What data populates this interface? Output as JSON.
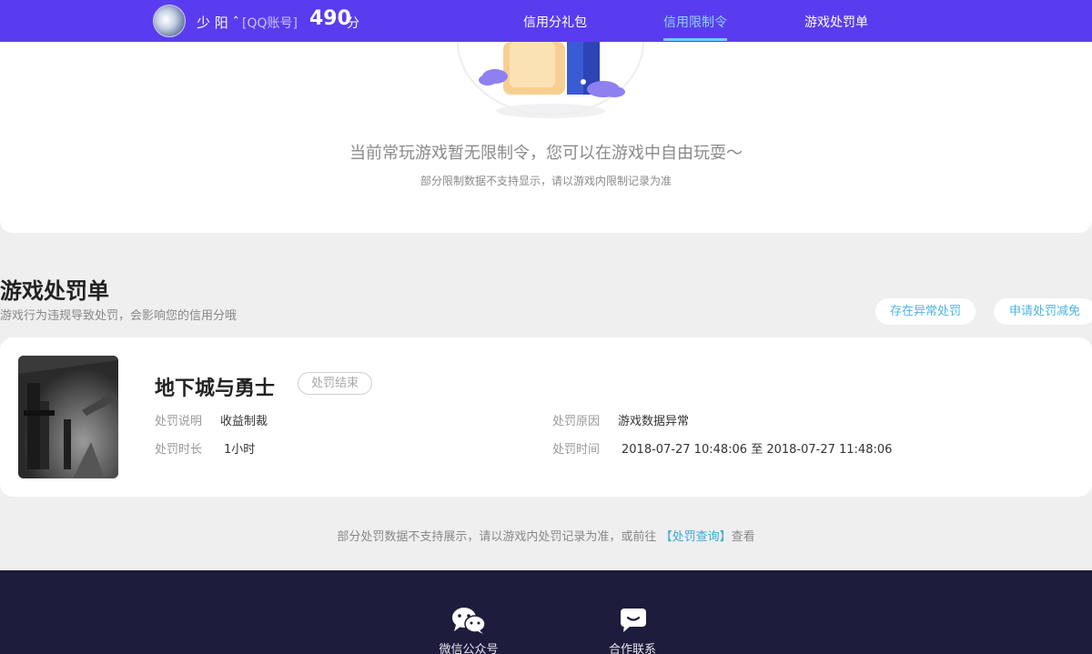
{
  "header": {
    "username": "少 阳 ˆ",
    "account_type": "[QQ账号]",
    "score": "490",
    "score_unit": "分",
    "nav": [
      {
        "label": "信用分礼包"
      },
      {
        "label": "信用限制令"
      },
      {
        "label": "游戏处罚单"
      }
    ]
  },
  "restriction": {
    "empty_text": "当前常玩游戏暂无限制令，您可以在游戏中自由玩耍～",
    "note": "部分限制数据不支持显示，请以游戏内限制记录为准"
  },
  "punishment": {
    "title": "游戏处罚单",
    "subtitle": "游戏行为违规导致处罚，会影响您的信用分哦",
    "buttons": {
      "appeal": "存在异常处罚",
      "reduce": "申请处罚减免"
    },
    "records": [
      {
        "game": "地下城与勇士",
        "status": "处罚结束",
        "desc_label": "处罚说明",
        "desc_value": "收益制裁",
        "duration_label": "处罚时长",
        "duration_value": "1小时",
        "reason_label": "处罚原因",
        "reason_value": "游戏数据异常",
        "time_label": "处罚时间",
        "time_value": "2018-07-27 10:48:06 至 2018-07-27 11:48:06"
      }
    ],
    "footnote": "部分处罚数据不支持展示，请以游戏内处罚记录为准，或前往",
    "footnote_link": "【处罚查询】",
    "footnote_tail": "查看"
  },
  "footer": {
    "items": [
      {
        "label": "微信公众号",
        "icon": "wechat-icon"
      },
      {
        "label": "合作联系",
        "icon": "message-icon"
      }
    ]
  },
  "colors": {
    "topbar": "#5a3cf0",
    "nav_active": "#8fd3ff",
    "link": "#3aa9d8",
    "footer": "#1d1c3d"
  }
}
